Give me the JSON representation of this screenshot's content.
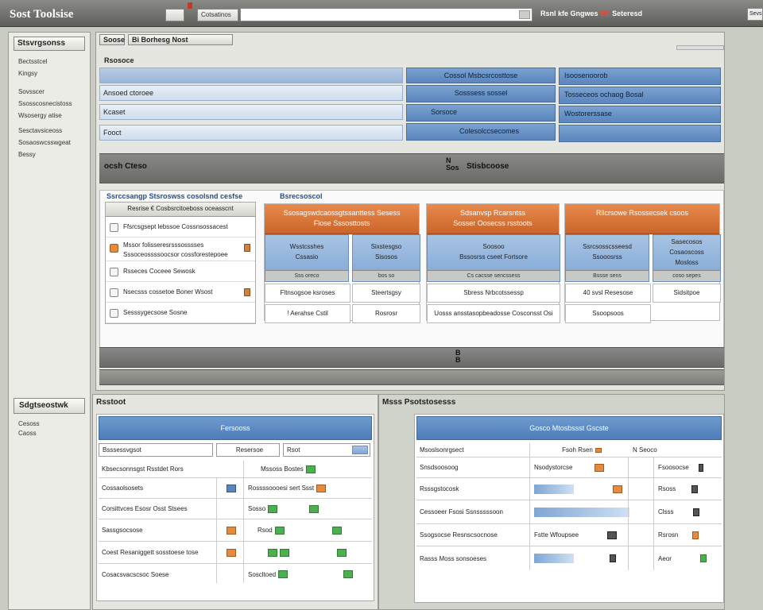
{
  "titlebar": {
    "app_title": "Sost Toolsise",
    "btn_small": "",
    "btn_label": "Cotsatinos",
    "right_text_a": "Rsnl kfe",
    "right_text_b": "Gngwes",
    "right_text_red": "BE",
    "right_text_c": "Seteresd",
    "small_right": "Sevsie"
  },
  "sidebar": {
    "header": "Stsvrgsonss",
    "items": [
      "Bectsstcel",
      "Kingsy",
      "Sovsscer",
      "Ssosscosnecistoss",
      "Wsosergy atise",
      "Sesctavsiceoss",
      "Sosaoswcsswgeat",
      "Bessy"
    ],
    "header2": "Sdgtseostwk",
    "sub_items": [
      "Cesoss",
      "Caoss"
    ]
  },
  "top": {
    "tab_a": "Soose",
    "tab_b": "Bi Borhesg Nost",
    "section_label": "Rsosoce",
    "strips": [
      "",
      "Ansoed ctoroee",
      "Kcaset",
      "Fooct"
    ],
    "mid_boxes": [
      "Cossol Msbcsrcosttose",
      "Sosssess sossel",
      "Sorsoce",
      "Colesolccsecomes"
    ],
    "right_boxes": [
      "Isoosenoorob",
      "Tosseceos ochaog Bosal",
      "Wostorerssase",
      ""
    ],
    "grey_bar_label": "ocsh Cteso",
    "grey_bar_right": "Stisbcoose",
    "vtext_a": "N Sos",
    "vtext_b": "B B"
  },
  "mid": {
    "title_left": "Ssrccsangp Stsroswss cosolsnd cesfse",
    "title_right": "Bsrecsoscol",
    "list_head": "Resrise € Cosbsrcitoeboss oceasscnt",
    "list_items": [
      "Ffsrcsgsept lebssoe Cossnsossacest",
      "Mssor folisseresrsssosssses",
      "Sssoceossssoocsor cossforestepoee",
      "Rsseces Coceee Sewosk",
      "Nsecsss cossetoe Boner Wsost",
      "Sesssygecsose Sosne"
    ],
    "cards": [
      {
        "head": "Ssosagswdcaossgtssanttess Sesess",
        "head2": "Flose Sssosttosts",
        "col_a": "Wsstcsshes\nCssasio",
        "col_b": "Sixstesgso\nSisosos",
        "foot_a": "Sss oreco",
        "foot_b": "bos so",
        "cell_a": "Fltnsogsoe ksroses",
        "cell_b": "Steertsgsy",
        "cell_c": "! Aerahse Cstil",
        "cell_d": "Rosrosr"
      },
      {
        "head": "Sdsanvsp Rcarsntss",
        "head2": "Sosser Oosecss rsstoots",
        "col_a": "Soosoo\nBssosrss cseet Fortsore",
        "col_b": "",
        "foot_a": "Cs cacsse sencssess",
        "cell_a": "Sbress Nrbcotssessp",
        "cell_b": "Uosss ansstasopbeadosse Cosconsst Osi"
      },
      {
        "head": "Rllcrsowe Rsossecsek csoos",
        "col_a": "Ssrcsosscsseesd\nSsooosrss",
        "col_b": "Sasecosos\nCosaoscoss\nMosloss",
        "foot_a": "Bssse sens",
        "foot_b": "coso sepes",
        "cell_a": "40 svsl Resesose",
        "cell_b": "Sidsitpoe",
        "cell_c": "Ssoopsoos"
      }
    ]
  },
  "bottom_left": {
    "title": "Rsstoot",
    "head": "Fersooss",
    "field_a": "Bsssessvgsot",
    "field_b": "Resersoe",
    "field_c": "Rsot",
    "rows": [
      {
        "a": "Kbsecsonnsgst Rsstdet Rors",
        "b": "Mssoss  Bostes"
      },
      {
        "a": "Cossaolsosets",
        "b": "Rossssoooesi sert Ssst"
      },
      {
        "a": "Corsittvces Esosr Osst Stsees",
        "b": "Sosso"
      },
      {
        "a": "Sassgsocsose",
        "b": "Rsod"
      },
      {
        "a": "Coest Resaniggett sosstoese tose",
        "b": ""
      },
      {
        "a": "Cosacsvacscsoc Soese",
        "b": "Soscltoed"
      }
    ]
  },
  "bottom_right": {
    "title": "Msss Psotstosesss",
    "head": "Gosco Mtosbssst Gscste",
    "header_a": "Msoslsonrgsect",
    "header_b": "Fsoh Rsen",
    "header_c": "N Seoco",
    "rows": [
      {
        "a": "Snsdsoosoog",
        "b": "Nsodystorcse",
        "c": "Fsoosocse"
      },
      {
        "a": "Rsssgstocosk",
        "b": "",
        "c": "Rsoss"
      },
      {
        "a": "Cessoeer Fsosi Ssnsssssoon",
        "b": "",
        "c": "Clsss"
      },
      {
        "a": "Ssogsocse Resnscsocnose",
        "b": "Fstte Wfoupsee",
        "c": "Rsrosn"
      },
      {
        "a": "Rasss Moss sonsoeses",
        "b": "",
        "c": "Aeor"
      }
    ]
  }
}
